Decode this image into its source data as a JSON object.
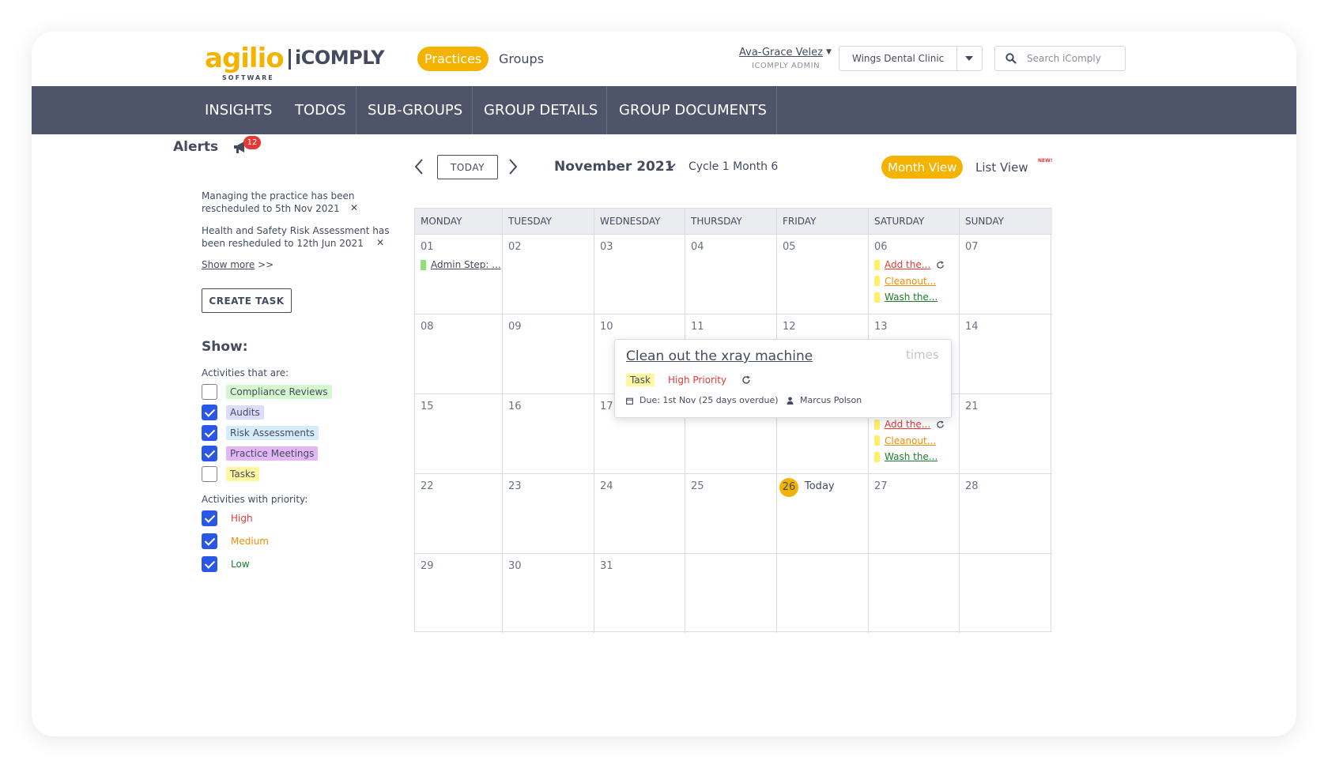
{
  "header": {
    "logo_agilio": "agilio",
    "logo_icomply": "iCOMPLY",
    "logo_software": "SOFTWARE",
    "practices_label": "Practices",
    "groups_label": "Groups",
    "user_name": "Ava-Grace Velez",
    "user_role": "ICOMPLY ADMIN",
    "clinic": "Wings Dental Clinic",
    "search_placeholder": "Search iComply"
  },
  "nav": {
    "items": [
      "INSIGHTS",
      "TODOS",
      "SUB-GROUPS",
      "GROUP DETAILS",
      "GROUP DOCUMENTS"
    ]
  },
  "alerts": {
    "title": "Alerts",
    "count": "12",
    "items": [
      {
        "line1": "Managing the practice has been",
        "line2": "rescheduled to 5th Nov 2021"
      },
      {
        "line1": "Health and Safety Risk Assessment has",
        "line2": "been resheduled to 12th Jun 2021"
      }
    ],
    "show_more": "Show more",
    "show_more_suffix": " >>",
    "close_glyph": "✕"
  },
  "create_task_label": "CREATE TASK",
  "filters": {
    "title": "Show:",
    "activities_label": "Activities that are:",
    "activities": [
      {
        "label": "Compliance Reviews",
        "checked": false,
        "bg": "#d4f7d0"
      },
      {
        "label": "Audits",
        "checked": true,
        "bg": "#dcdcfb"
      },
      {
        "label": "Risk Assessments",
        "checked": true,
        "bg": "#d5ecfb"
      },
      {
        "label": "Practice Meetings",
        "checked": true,
        "bg": "#e3b7f5"
      },
      {
        "label": "Tasks",
        "checked": false,
        "bg": "#fff8a0"
      }
    ],
    "priority_label": "Activities with priority:",
    "priorities": [
      {
        "label": "High",
        "checked": true,
        "color": "#e53935"
      },
      {
        "label": "Medium",
        "checked": true,
        "color": "#f08c00"
      },
      {
        "label": "Low",
        "checked": true,
        "color": "#1e7a2e"
      }
    ]
  },
  "calendar": {
    "today_label": "TODAY",
    "month": "November 2021",
    "cycle": "Cycle 1 Month 6",
    "month_view_label": "Month View",
    "list_view_label": "List View",
    "new_badge": "NEW!",
    "weekdays": [
      "MONDAY",
      "TUESDAY",
      "WEDNESDAY",
      "THURSDAY",
      "FRIDAY",
      "SATURDAY",
      "SUNDAY"
    ],
    "weeks": [
      [
        "01",
        "02",
        "03",
        "04",
        "05",
        "06",
        "07"
      ],
      [
        "08",
        "09",
        "10",
        "11",
        "12",
        "13",
        "14"
      ],
      [
        "15",
        "16",
        "17",
        "",
        "",
        "",
        "21"
      ],
      [
        "22",
        "23",
        "24",
        "25",
        "26",
        "27",
        "28"
      ],
      [
        "29",
        "30",
        "31",
        "",
        "",
        "",
        ""
      ]
    ],
    "today_text": "Today",
    "events": [
      {
        "week": 0,
        "day": 0,
        "label": "Admin Step: ...",
        "bar": "#8ee07a",
        "color": "#454b5e",
        "repeat": false
      },
      {
        "week": 0,
        "day": 5,
        "label": "Add the...",
        "bar": "#fff06a",
        "color": "#e53935",
        "repeat": true
      },
      {
        "week": 0,
        "day": 5,
        "label": "Cleanout...",
        "bar": "#fff06a",
        "color": "#f08c00",
        "repeat": false
      },
      {
        "week": 0,
        "day": 5,
        "label": "Wash the...",
        "bar": "#fff06a",
        "color": "#1e7a2e",
        "repeat": false
      },
      {
        "week": 2,
        "day": 5,
        "label": "Add the...",
        "bar": "#fff06a",
        "color": "#e53935",
        "repeat": true
      },
      {
        "week": 2,
        "day": 5,
        "label": "Cleanout...",
        "bar": "#fff06a",
        "color": "#f08c00",
        "repeat": false
      },
      {
        "week": 2,
        "day": 5,
        "label": "Wash the...",
        "bar": "#fff06a",
        "color": "#1e7a2e",
        "repeat": false
      }
    ]
  },
  "popover": {
    "title": "Clean out the xray machine",
    "close_label": "times",
    "tag": "Task",
    "priority": "High Priority",
    "due": "Due: 1st Nov (25 days overdue)",
    "assignee": "Marcus Polson"
  },
  "colors": {
    "accent": "#f5b301",
    "nav_bg": "#4e5469",
    "text": "#454b5e",
    "checkbox": "#2b57e6"
  }
}
